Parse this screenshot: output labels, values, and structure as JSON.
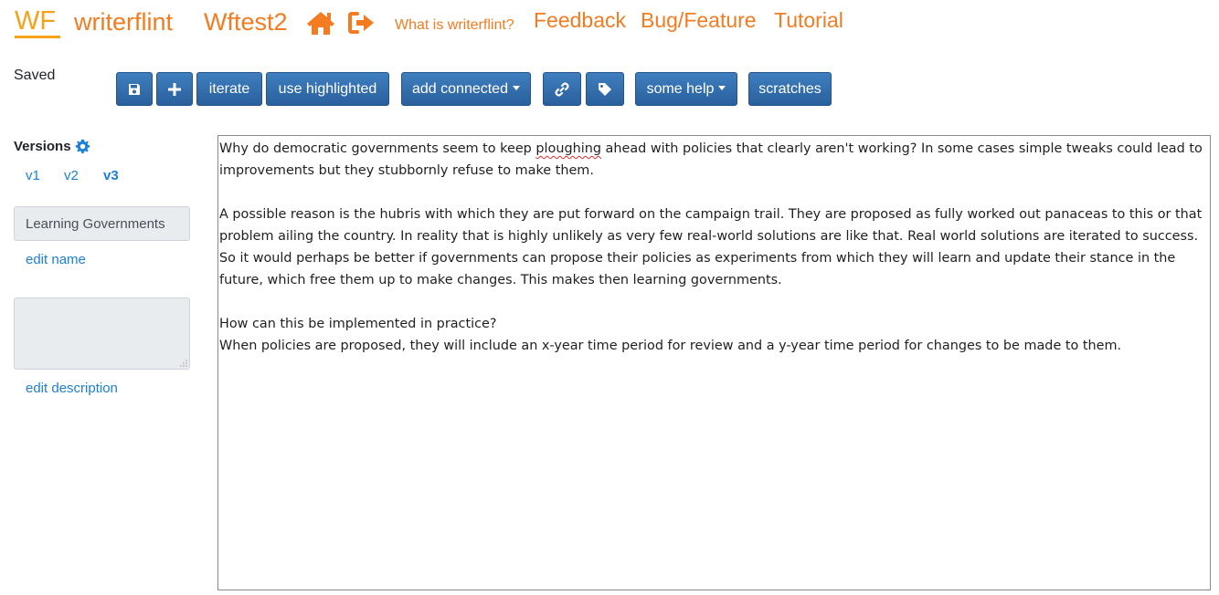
{
  "nav": {
    "logo": "WF",
    "brand": "writerflint",
    "project": "Wftest2",
    "home_icon": "home-icon",
    "logout_icon": "sign-out-icon",
    "what_is": "What is writerflint?",
    "feedback": "Feedback",
    "bug_feature": "Bug/Feature",
    "tutorial": "Tutorial",
    "accent_color": "#f47b20",
    "logo_color": "#f4a11b"
  },
  "toolbar": {
    "status": "Saved",
    "save_icon": "save-icon",
    "add_icon": "plus-icon",
    "iterate": "iterate",
    "use_highlighted": "use highlighted",
    "add_connected": "add connected",
    "link_icon": "link-icon",
    "tag_icon": "tag-icon",
    "some_help": "some help",
    "scratches": "scratches",
    "button_color": "#2f6aa8"
  },
  "sidebar": {
    "versions_title": "Versions",
    "versions_icon": "gear-icon",
    "versions": [
      "v1",
      "v2",
      "v3"
    ],
    "active_version": "v3",
    "name_value": "Learning Governments",
    "edit_name": "edit name",
    "description_value": "",
    "edit_description": "edit description",
    "link_color": "#1a7fd6"
  },
  "editor": {
    "p1_before": "Why do democratic governments seem to keep ",
    "p1_misspelled": "ploughing",
    "p1_after": " ahead with policies that clearly aren't working? In some cases simple tweaks could lead to improvements but they stubbornly refuse to make them.",
    "p2": "A possible reason is the hubris with which they are put forward on the campaign trail. They are proposed as fully worked out panaceas to this or that problem ailing the country. In reality that is highly unlikely as very few real-world solutions are like that. Real world solutions are iterated to success. So it would perhaps be better if governments can propose their policies as experiments from which they will learn and update their stance in the future, which free them up to make changes. This makes then learning governments.",
    "p3": "How can this be implemented in practice?",
    "p4": "When policies are proposed, they will include an x-year time period for review and a y-year time period for changes to be made to them."
  }
}
